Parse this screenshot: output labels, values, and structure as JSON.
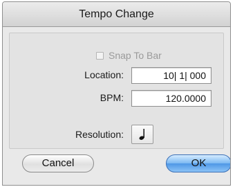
{
  "dialog": {
    "title": "Tempo Change",
    "snap_to_bar": {
      "label": "Snap To Bar",
      "checked": false
    },
    "location": {
      "label": "Location:",
      "value": "10| 1| 000"
    },
    "bpm": {
      "label": "BPM:",
      "value": "120.0000"
    },
    "resolution": {
      "label": "Resolution:",
      "icon": "quarter-note-icon"
    },
    "cancel_label": "Cancel",
    "ok_label": "OK"
  }
}
